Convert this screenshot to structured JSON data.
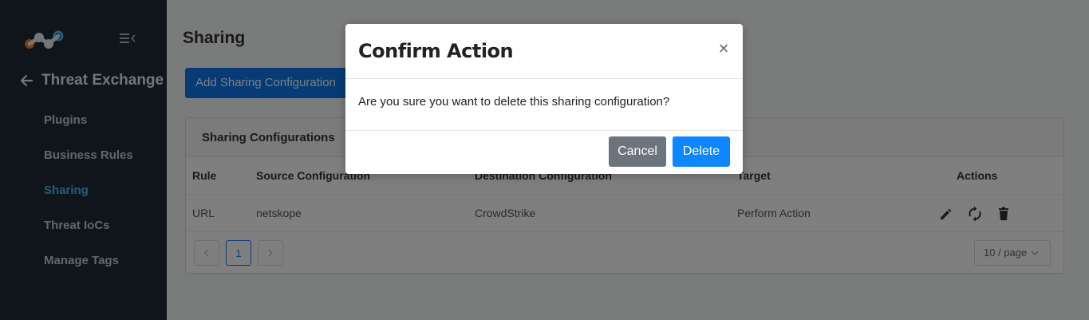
{
  "sidebar": {
    "back_title": "Threat Exchange",
    "items": [
      {
        "label": "Plugins"
      },
      {
        "label": "Business Rules"
      },
      {
        "label": "Sharing",
        "active": true
      },
      {
        "label": "Threat IoCs"
      },
      {
        "label": "Manage Tags"
      }
    ]
  },
  "main": {
    "page_title": "Sharing",
    "add_button": "Add Sharing Configuration",
    "card_title": "Sharing Configurations",
    "columns": [
      "Rule",
      "Source Configuration",
      "Destination Configuration",
      "Target",
      "Actions"
    ],
    "rows": [
      {
        "rule": "URL",
        "source": "netskope",
        "destination": "CrowdStrike",
        "target": "Perform Action"
      }
    ],
    "pagination": {
      "current_page": "1",
      "page_size": "10 / page"
    }
  },
  "modal": {
    "title": "Confirm Action",
    "close_glyph": "×",
    "message": "Are you sure you want to delete this sharing configuration?",
    "cancel_label": "Cancel",
    "delete_label": "Delete"
  },
  "colors": {
    "sidebar_bg": "#1e2a36",
    "active_nav": "#3fc2ec",
    "primary": "#0d86ff",
    "secondary": "#6c757d"
  }
}
